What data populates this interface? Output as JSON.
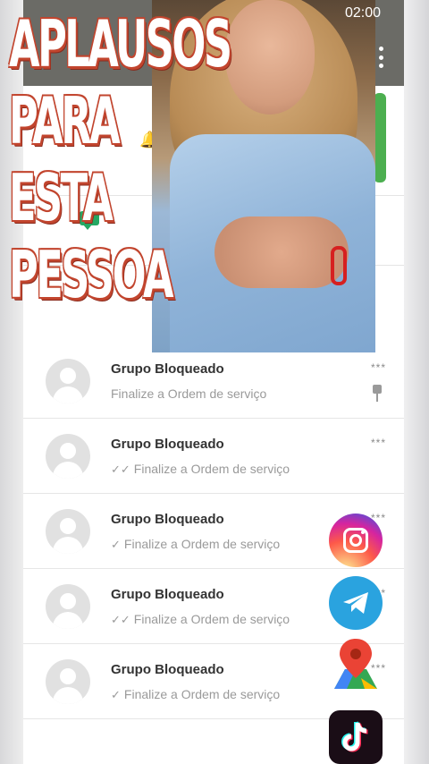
{
  "status_bar": {
    "time": "02:00"
  },
  "overlay": {
    "caption": "APLAUSOS\nPARA ESTA\nPESSOA"
  },
  "chats": [
    {
      "title": "Grupo Bloqueado",
      "subtitle": "Finalize a Ordem de serviço",
      "meta": "***",
      "status": "pinned",
      "check": ""
    },
    {
      "title": "Grupo Bloqueado",
      "subtitle": "Finalize a Ordem de serviço",
      "meta": "***",
      "status": "read",
      "check": "✓✓"
    },
    {
      "title": "Grupo Bloqueado",
      "subtitle": "Finalize a Ordem de serviço",
      "meta": "***",
      "status": "sent",
      "check": "✓"
    },
    {
      "title": "Grupo Bloqueado",
      "subtitle": "Finalize a Ordem de serviço",
      "meta": "***",
      "status": "read",
      "check": "✓✓"
    },
    {
      "title": "Grupo Bloqueado",
      "subtitle": "Finalize a Ordem de serviço",
      "meta": "***",
      "status": "sent",
      "check": "✓"
    }
  ],
  "social_icons": [
    "instagram-icon",
    "telegram-icon",
    "maps-icon",
    "tiktok-icon"
  ],
  "colors": {
    "appbar": "#6b6b66",
    "accent_green": "#4caf50",
    "text_primary": "#333333",
    "text_secondary": "#9a9a9a"
  }
}
